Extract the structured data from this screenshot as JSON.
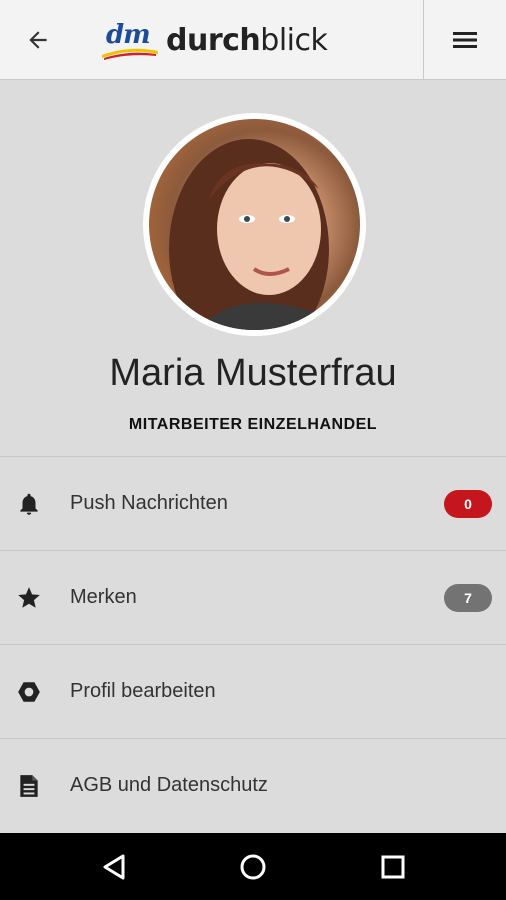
{
  "header": {
    "logo_dm": "dm",
    "logo_bold": "durch",
    "logo_light": "blick",
    "brand_colors": {
      "blue": "#1e4a9a",
      "yellow": "#f2c200",
      "red": "#d0202a"
    }
  },
  "profile": {
    "name": "Maria Musterfrau",
    "role": "MITARBEITER EINZELHANDEL"
  },
  "menu": [
    {
      "label": "Push Nachrichten",
      "icon": "bell-icon",
      "badge": "0",
      "badge_color": "#c4161c"
    },
    {
      "label": "Merken",
      "icon": "star-icon",
      "badge": "7",
      "badge_color": "#737373"
    },
    {
      "label": "Profil bearbeiten",
      "icon": "hexagon-nut-icon",
      "badge": null
    },
    {
      "label": "AGB und Datenschutz",
      "icon": "document-icon",
      "badge": null
    }
  ],
  "navbar": {
    "back_icon": "triangle-back-icon",
    "home_icon": "circle-home-icon",
    "recents_icon": "square-recents-icon"
  }
}
